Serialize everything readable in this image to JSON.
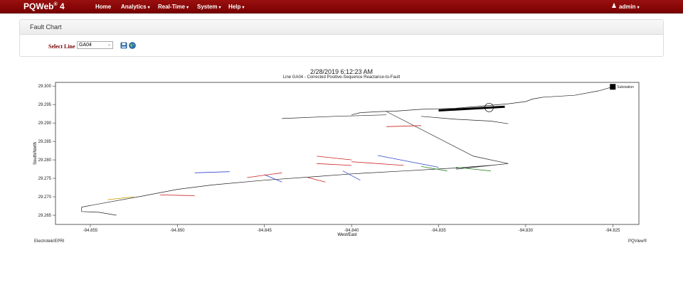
{
  "nav": {
    "brand": "PQWeb",
    "brand_sup": "®",
    "brand_version": " 4",
    "items": [
      {
        "label": "Home",
        "dropdown": false
      },
      {
        "label": "Analytics",
        "dropdown": true
      },
      {
        "label": "Real-Time",
        "dropdown": true
      },
      {
        "label": "System",
        "dropdown": true
      },
      {
        "label": "Help",
        "dropdown": true
      }
    ],
    "user": "admin",
    "bar_color": "#8b0000"
  },
  "panel": {
    "title": "Fault Chart",
    "select_label": "Select Line",
    "select_value": "GA04",
    "icons": [
      "save-icon",
      "globe-icon"
    ]
  },
  "chart_data": {
    "type": "line",
    "title": "2/28/2019 6:12:23 AM",
    "subtitle": "Line GA04 - Corrected Positive-Sequence Reactance-to-Fault",
    "xlabel": "West/East",
    "ylabel": "South/North",
    "xlim": [
      -94.857,
      -94.8235
    ],
    "ylim": [
      29.2625,
      29.301
    ],
    "xticks": [
      "-94.855",
      "-94.850",
      "-94.845",
      "-94.840",
      "-94.835",
      "-94.830",
      "-94.825"
    ],
    "yticks": [
      "29.300",
      "29.295",
      "29.290",
      "29.285",
      "29.280",
      "29.275",
      "29.270",
      "29.265"
    ],
    "legend": "Substation",
    "substation": {
      "x": -94.825,
      "y": 29.2998
    },
    "fault_circle": {
      "x": -94.8321,
      "y": 29.2942
    },
    "fault_segment": {
      "x": [
        -94.835,
        -94.8312
      ],
      "y": [
        29.2934,
        29.2944
      ]
    },
    "main_series": [
      {
        "name": "trunk-north",
        "color": "#222222",
        "x": [
          -94.825,
          -94.8258,
          -94.8272,
          -94.829,
          -94.8296,
          -94.83,
          -94.831,
          -94.834,
          -94.836,
          -94.8375,
          -94.8383,
          -94.8395,
          -94.84
        ],
        "y": [
          29.2998,
          29.2987,
          29.2975,
          29.297,
          29.2965,
          29.2958,
          29.2952,
          29.294,
          29.2937,
          29.2932,
          29.2931,
          29.2928,
          29.2922
        ]
      },
      {
        "name": "trunk-diagonal",
        "color": "#222222",
        "x": [
          -94.838,
          -94.833,
          -94.831,
          -94.832,
          -94.834
        ],
        "y": [
          29.2931,
          29.281,
          29.279,
          29.2785,
          29.2775
        ]
      },
      {
        "name": "trunk-south",
        "color": "#222222",
        "x": [
          -94.832,
          -94.834,
          -94.837,
          -94.84,
          -94.842,
          -94.845,
          -94.848,
          -94.85,
          -94.852,
          -94.854,
          -94.8555
        ],
        "y": [
          29.2785,
          29.2778,
          29.277,
          29.2762,
          29.2755,
          29.2745,
          29.2732,
          29.272,
          29.2702,
          29.2685,
          29.2672
        ]
      },
      {
        "name": "west-stub",
        "color": "#222222",
        "x": [
          -94.8555,
          -94.8555,
          -94.8545,
          -94.8535
        ],
        "y": [
          29.2672,
          29.266,
          29.2658,
          29.265
        ]
      },
      {
        "name": "upper-branch",
        "color": "#222222",
        "x": [
          -94.838,
          -94.841,
          -94.844
        ],
        "y": [
          29.2922,
          29.2918,
          29.2912
        ]
      },
      {
        "name": "east-branch",
        "color": "#222222",
        "x": [
          -94.836,
          -94.834,
          -94.832,
          -94.831
        ],
        "y": [
          29.2918,
          29.291,
          29.2905,
          29.2898
        ]
      }
    ],
    "laterals": [
      {
        "color": "#cc2222",
        "x": [
          -94.838,
          -94.836
        ],
        "y": [
          29.289,
          29.2893
        ]
      },
      {
        "color": "#cc2222",
        "x": [
          -94.842,
          -94.84
        ],
        "y": [
          29.281,
          29.28
        ]
      },
      {
        "color": "#cc2222",
        "x": [
          -94.84,
          -94.837
        ],
        "y": [
          29.2795,
          29.2785
        ]
      },
      {
        "color": "#3344cc",
        "x": [
          -94.8385,
          -94.835
        ],
        "y": [
          29.2812,
          29.278
        ]
      },
      {
        "color": "#3344cc",
        "x": [
          -94.845,
          -94.844
        ],
        "y": [
          29.276,
          29.274
        ]
      },
      {
        "color": "#cc2222",
        "x": [
          -94.846,
          -94.844
        ],
        "y": [
          29.2752,
          29.2765
        ]
      },
      {
        "color": "#2c8a2c",
        "x": [
          -94.836,
          -94.8345
        ],
        "y": [
          29.2782,
          29.277
        ]
      },
      {
        "color": "#2c8a2c",
        "x": [
          -94.834,
          -94.832
        ],
        "y": [
          29.278,
          29.277
        ]
      },
      {
        "color": "#3344cc",
        "x": [
          -94.849,
          -94.847
        ],
        "y": [
          29.2765,
          29.2768
        ]
      },
      {
        "color": "#cc2222",
        "x": [
          -94.842,
          -94.84
        ],
        "y": [
          29.279,
          29.2785
        ]
      },
      {
        "color": "#3344cc",
        "x": [
          -94.8405,
          -94.8395
        ],
        "y": [
          29.277,
          29.2745
        ]
      },
      {
        "color": "#cc2222",
        "x": [
          -94.8425,
          -94.8415
        ],
        "y": [
          29.2752,
          29.274
        ]
      },
      {
        "color": "#cc2222",
        "x": [
          -94.851,
          -94.849
        ],
        "y": [
          29.2705,
          29.2703
        ]
      },
      {
        "color": "#c9a200",
        "x": [
          -94.854,
          -94.8525
        ],
        "y": [
          29.2692,
          29.27
        ]
      }
    ]
  },
  "footer": {
    "left": "Electrotek/EPRI",
    "right": "PQView®"
  }
}
